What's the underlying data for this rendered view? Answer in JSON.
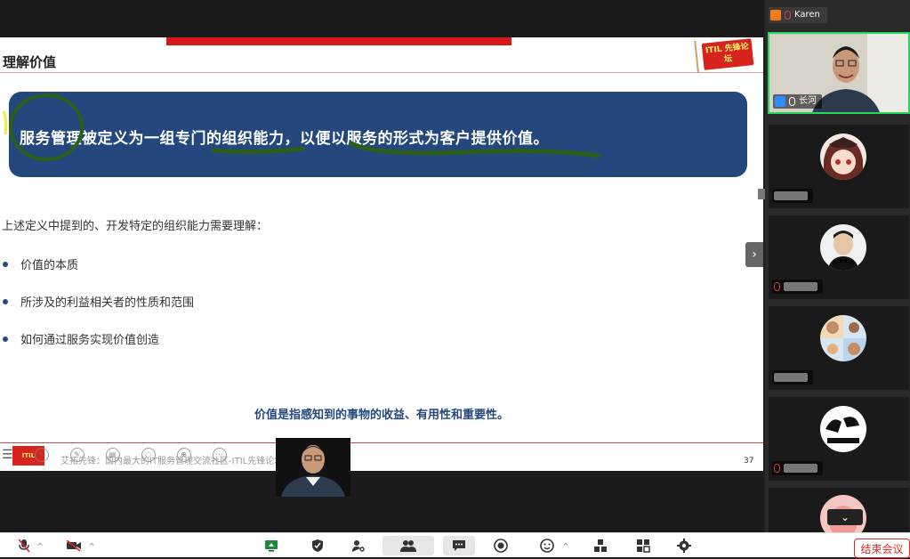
{
  "slide": {
    "title": "理解价值",
    "logo_text": "ITIL 先锋论坛",
    "definition": "服务管理被定义为一组专门的组织能力，以便以服务的形式为客户提供价值。",
    "intro": "上述定义中提到的、开发特定的组织能力需要理解：",
    "bullets": [
      "价值的本质",
      "所涉及的利益相关者的性质和范围",
      "如何通过服务实现价值创造"
    ],
    "value_definition": "价值是指感知到的事物的收益、有用性和重要性。",
    "footer": "艾拓先锋：国内最大的IT服务管理交流社区-ITIL先锋论坛　运营机构",
    "page_number": "37",
    "annotation_color": "#2b5e16",
    "box_color": "#24487e"
  },
  "gallery": {
    "top_label": "Karen",
    "active_speaker": "长河",
    "active_border_color": "#23d959"
  },
  "toolbar": {
    "end_meeting": "结束会议"
  }
}
